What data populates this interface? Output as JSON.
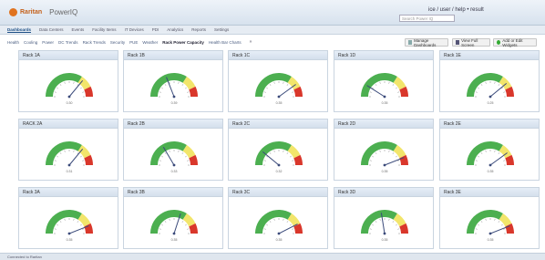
{
  "header": {
    "brand": "Raritan",
    "product": "PowerIQ",
    "user_links": "ice / user / help • result",
    "search_placeholder": "Search Power IQ"
  },
  "nav": {
    "items": [
      {
        "label": "Dashboards",
        "active": true
      },
      {
        "label": "Data Centers",
        "active": false
      },
      {
        "label": "Events",
        "active": false
      },
      {
        "label": "Facility Items",
        "active": false
      },
      {
        "label": "IT Devices",
        "active": false
      },
      {
        "label": "PDI",
        "active": false
      },
      {
        "label": "Analytics",
        "active": false
      },
      {
        "label": "Reports",
        "active": false
      },
      {
        "label": "Settings",
        "active": false
      }
    ]
  },
  "sub_nav": {
    "items": [
      {
        "label": "Health",
        "active": false
      },
      {
        "label": "Cooling",
        "active": false
      },
      {
        "label": "Power",
        "active": false
      },
      {
        "label": "DC Trends",
        "active": false
      },
      {
        "label": "Rack Trends",
        "active": false
      },
      {
        "label": "Security",
        "active": false
      },
      {
        "label": "PUE",
        "active": false
      },
      {
        "label": "Weather",
        "active": false
      },
      {
        "label": "Rack Power Capacity",
        "active": true
      },
      {
        "label": "Health Bar Charts",
        "active": false
      }
    ],
    "more": "»"
  },
  "toolbar": {
    "manage_label": "Manage Dashboards",
    "fullscreen_label": "View Full Screen",
    "add_label": "Add or Edit Widgets"
  },
  "gauges": [
    {
      "title": "Rack 1A",
      "value": 0.72,
      "readout": "0.30"
    },
    {
      "title": "Rack 1B",
      "value": 0.38,
      "readout": "0.39"
    },
    {
      "title": "Rack 1C",
      "value": 0.8,
      "readout": "0.35"
    },
    {
      "title": "Rack 1D",
      "value": 0.18,
      "readout": "0.35"
    },
    {
      "title": "Rack 1E",
      "value": 0.78,
      "readout": "0.25"
    },
    {
      "title": "RACK 2A",
      "value": 0.72,
      "readout": "0.31"
    },
    {
      "title": "Rack 2B",
      "value": 0.33,
      "readout": "0.33"
    },
    {
      "title": "Rack 2C",
      "value": 0.22,
      "readout": "0.32"
    },
    {
      "title": "Rack 2D",
      "value": 0.88,
      "readout": "0.35"
    },
    {
      "title": "Rack 2E",
      "value": 0.8,
      "readout": "0.35"
    },
    {
      "title": "Rack 3A",
      "value": 0.88,
      "readout": "0.35"
    },
    {
      "title": "Rack 3B",
      "value": 0.6,
      "readout": "0.35"
    },
    {
      "title": "Rack 3C",
      "value": 0.85,
      "readout": "0.35"
    },
    {
      "title": "Rack 3D",
      "value": 0.45,
      "readout": "0.35"
    },
    {
      "title": "Rack 3E",
      "value": 0.88,
      "readout": "0.35"
    }
  ],
  "status_bar": {
    "text": "Connected to Raritan"
  },
  "colors": {
    "green": "#4caf50",
    "yellow": "#f2e56b",
    "red": "#d9372b",
    "header_bg": "#dde6f0"
  }
}
